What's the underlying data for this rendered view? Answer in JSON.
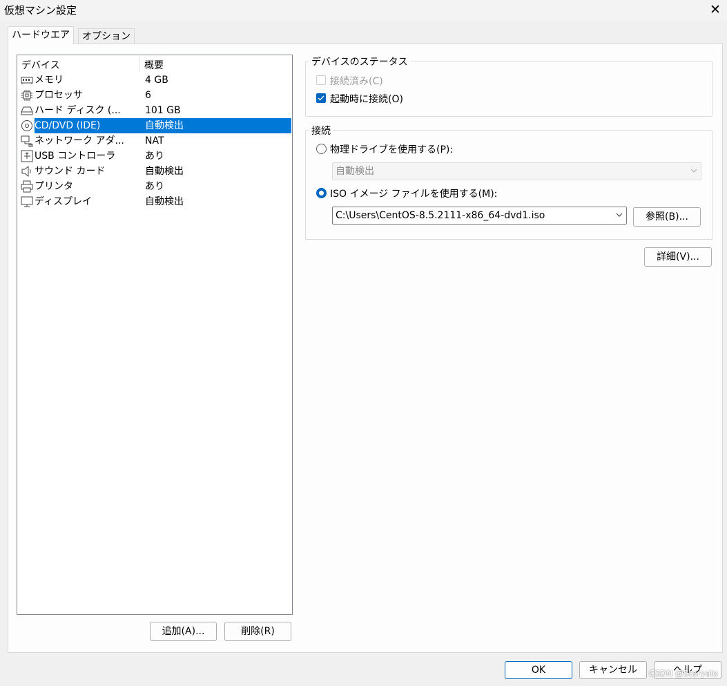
{
  "window": {
    "title": "仮想マシン設定",
    "close_glyph": "✕"
  },
  "tabs": [
    {
      "label": "ハードウエア",
      "selected": true
    },
    {
      "label": "オプション",
      "selected": false
    }
  ],
  "device_list": {
    "columns": [
      "デバイス",
      "概要"
    ],
    "rows": [
      {
        "icon": "memory-icon",
        "name": "メモリ",
        "summary": "4 GB",
        "selected": false
      },
      {
        "icon": "processor-icon",
        "name": "プロセッサ",
        "summary": "6",
        "selected": false
      },
      {
        "icon": "hard-disk-icon",
        "name": "ハード ディスク (...",
        "summary": "101 GB",
        "selected": false
      },
      {
        "icon": "cd-dvd-icon",
        "name": "CD/DVD (IDE)",
        "summary": "自動検出",
        "selected": true
      },
      {
        "icon": "network-adapter-icon",
        "name": "ネットワーク アダ...",
        "summary": "NAT",
        "selected": false
      },
      {
        "icon": "usb-icon",
        "name": "USB コントローラ",
        "summary": "あり",
        "selected": false
      },
      {
        "icon": "sound-card-icon",
        "name": "サウンド カード",
        "summary": "自動検出",
        "selected": false
      },
      {
        "icon": "printer-icon",
        "name": "プリンタ",
        "summary": "あり",
        "selected": false
      },
      {
        "icon": "display-icon",
        "name": "ディスプレイ",
        "summary": "自動検出",
        "selected": false
      }
    ],
    "add_label": "追加(A)...",
    "remove_label": "削除(R)"
  },
  "device_status": {
    "legend": "デバイスのステータス",
    "connected_label": "接続済み(C)",
    "connected_checked": false,
    "connected_disabled": true,
    "connect_at_power_on_label": "起動時に接続(O)",
    "connect_at_power_on_checked": true
  },
  "connection": {
    "legend": "接続",
    "physical_drive_label": "物理ドライブを使用する(P):",
    "physical_drive_selected": false,
    "physical_drive_value": "自動検出",
    "iso_label": "ISO イメージ ファイルを使用する(M):",
    "iso_selected": true,
    "iso_path": "C:\\Users\\CentOS-8.5.2111-x86_64-dvd1.iso",
    "browse_label": "参照(B)..."
  },
  "advanced_label": "詳細(V)...",
  "footer": {
    "ok_label": "OK",
    "cancel_label": "キャンセル",
    "help_label": "ヘルプ"
  },
  "watermark": "CSDN @Staryalo",
  "colors": {
    "selection": "#0078d7",
    "accent": "#0067c0"
  }
}
